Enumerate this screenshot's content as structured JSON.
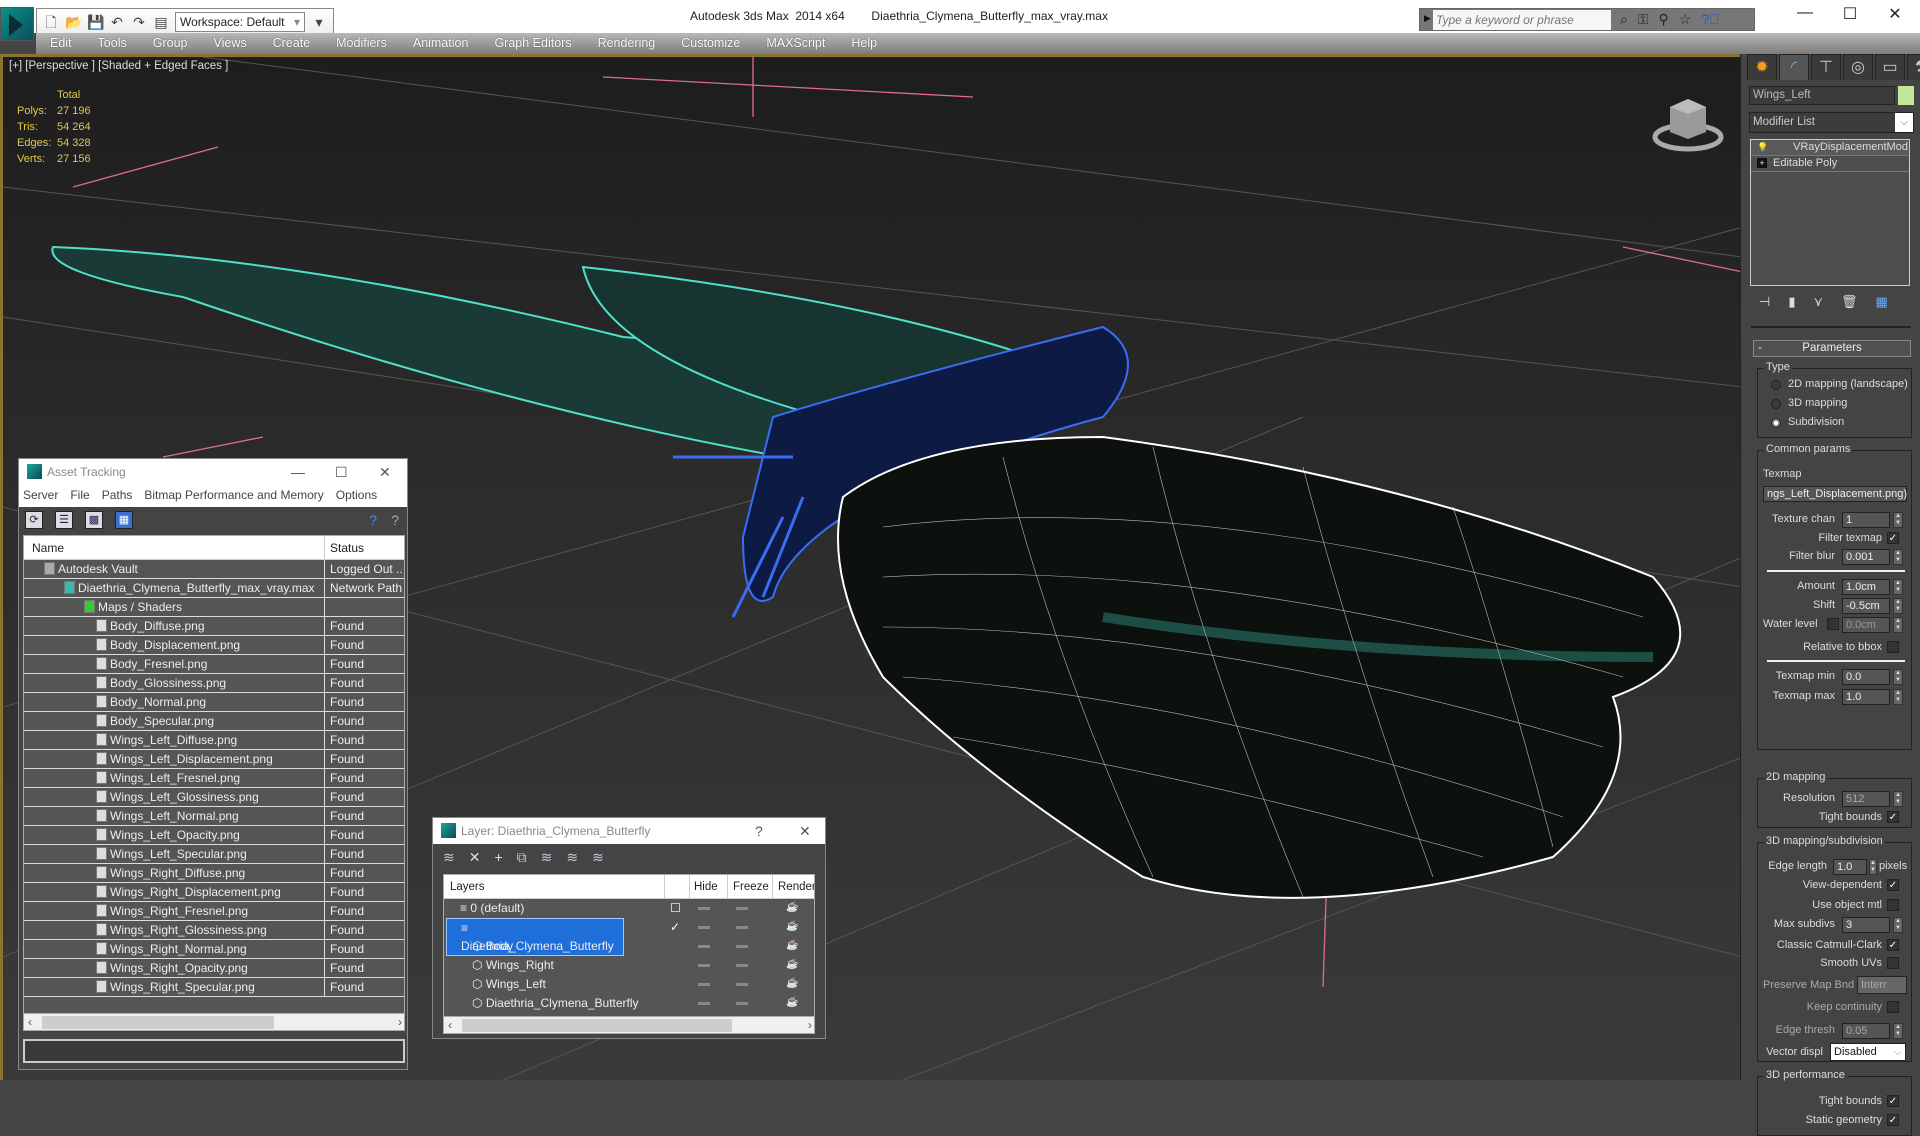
{
  "app": {
    "title": "Autodesk 3ds Max  2014 x64        Diaethria_Clymena_Butterfly_max_vray.max",
    "workspace": "Workspace: Default",
    "search_placeholder": "Type a keyword or phrase",
    "window_controls": [
      "—",
      "☐",
      "✕"
    ]
  },
  "menu": [
    "Edit",
    "Tools",
    "Group",
    "Views",
    "Create",
    "Modifiers",
    "Animation",
    "Graph Editors",
    "Rendering",
    "Customize",
    "MAXScript",
    "Help"
  ],
  "viewport": {
    "label": "[+] [Perspective ] [Shaded + Edged Faces ]",
    "stats_header": "Total",
    "stats": [
      {
        "k": "Polys:",
        "v": "27 196"
      },
      {
        "k": "Tris:",
        "v": "54 264"
      },
      {
        "k": "Edges:",
        "v": "54 328"
      },
      {
        "k": "Verts:",
        "v": "27 156"
      }
    ]
  },
  "command_panel": {
    "object_name": "Wings_Left",
    "object_color": "#c1e89a",
    "modifier_list": "Modifier List",
    "stack": [
      "VRayDisplacementMod",
      "Editable Poly"
    ],
    "rollout_title": "Parameters",
    "type_group": "Type",
    "type_options": [
      "2D mapping (landscape)",
      "3D mapping",
      "Subdivision"
    ],
    "type_selected": "Subdivision",
    "common_group": "Common params",
    "texmap_label": "Texmap",
    "texmap_value": "ngs_Left_Displacement.png)",
    "texture_chan": {
      "label": "Texture chan",
      "value": "1"
    },
    "filter_texmap": {
      "label": "Filter texmap",
      "checked": true
    },
    "filter_blur": {
      "label": "Filter blur",
      "value": "0.001"
    },
    "amount": {
      "label": "Amount",
      "value": "1.0cm"
    },
    "shift": {
      "label": "Shift",
      "value": "-0.5cm"
    },
    "water_level": {
      "label": "Water level",
      "value": "0.0cm",
      "checked": false
    },
    "relative_bbox": {
      "label": "Relative to bbox",
      "checked": false
    },
    "texmap_min": {
      "label": "Texmap min",
      "value": "0.0"
    },
    "texmap_max": {
      "label": "Texmap max",
      "value": "1.0"
    },
    "mapping2d_group": "2D mapping",
    "resolution": {
      "label": "Resolution",
      "value": "512"
    },
    "tight_bounds_2d": {
      "label": "Tight bounds",
      "checked": true
    },
    "mapping3d_group": "3D mapping/subdivision",
    "edge_length": {
      "label": "Edge length",
      "value": "1.0",
      "unit": "pixels"
    },
    "view_dependent": {
      "label": "View-dependent",
      "checked": true
    },
    "use_object_mtl": {
      "label": "Use object mtl",
      "checked": false
    },
    "max_subdivs": {
      "label": "Max subdivs",
      "value": "3"
    },
    "classic_cc": {
      "label": "Classic Catmull-Clark",
      "checked": true
    },
    "smooth_uvs": {
      "label": "Smooth UVs",
      "checked": false
    },
    "preserve_map": {
      "label": "Preserve Map Bnd",
      "value": "Interr"
    },
    "keep_continuity": {
      "label": "Keep continuity",
      "checked": false
    },
    "edge_thresh": {
      "label": "Edge thresh",
      "value": "0.05"
    },
    "vector_displ": {
      "label": "Vector displ",
      "value": "Disabled"
    },
    "perf_group": "3D performance",
    "tight_bounds_3d": {
      "label": "Tight bounds",
      "checked": true
    },
    "static_geometry": {
      "label": "Static geometry",
      "checked": true
    }
  },
  "asset_tracking": {
    "title": "Asset Tracking",
    "menu": [
      "Server",
      "File",
      "Paths",
      "Bitmap Performance and Memory",
      "Options"
    ],
    "columns": [
      "Name",
      "Status"
    ],
    "rows": [
      {
        "name": "Autodesk Vault",
        "status": "Logged Out ..",
        "level": 0
      },
      {
        "name": "Diaethria_Clymena_Butterfly_max_vray.max",
        "status": "Network Path",
        "level": 1
      },
      {
        "name": "Maps / Shaders",
        "status": "",
        "level": 2
      },
      {
        "name": "Body_Diffuse.png",
        "status": "Found",
        "level": 3
      },
      {
        "name": "Body_Displacement.png",
        "status": "Found",
        "level": 3
      },
      {
        "name": "Body_Fresnel.png",
        "status": "Found",
        "level": 3
      },
      {
        "name": "Body_Glossiness.png",
        "status": "Found",
        "level": 3
      },
      {
        "name": "Body_Normal.png",
        "status": "Found",
        "level": 3
      },
      {
        "name": "Body_Specular.png",
        "status": "Found",
        "level": 3
      },
      {
        "name": "Wings_Left_Diffuse.png",
        "status": "Found",
        "level": 3
      },
      {
        "name": "Wings_Left_Displacement.png",
        "status": "Found",
        "level": 3
      },
      {
        "name": "Wings_Left_Fresnel.png",
        "status": "Found",
        "level": 3
      },
      {
        "name": "Wings_Left_Glossiness.png",
        "status": "Found",
        "level": 3
      },
      {
        "name": "Wings_Left_Normal.png",
        "status": "Found",
        "level": 3
      },
      {
        "name": "Wings_Left_Opacity.png",
        "status": "Found",
        "level": 3
      },
      {
        "name": "Wings_Left_Specular.png",
        "status": "Found",
        "level": 3
      },
      {
        "name": "Wings_Right_Diffuse.png",
        "status": "Found",
        "level": 3
      },
      {
        "name": "Wings_Right_Displacement.png",
        "status": "Found",
        "level": 3
      },
      {
        "name": "Wings_Right_Fresnel.png",
        "status": "Found",
        "level": 3
      },
      {
        "name": "Wings_Right_Glossiness.png",
        "status": "Found",
        "level": 3
      },
      {
        "name": "Wings_Right_Normal.png",
        "status": "Found",
        "level": 3
      },
      {
        "name": "Wings_Right_Opacity.png",
        "status": "Found",
        "level": 3
      },
      {
        "name": "Wings_Right_Specular.png",
        "status": "Found",
        "level": 3
      }
    ]
  },
  "layer_dialog": {
    "title": "Layer: Diaethria_Clymena_Butterfly",
    "help": "?",
    "columns": [
      "Layers",
      "Hide",
      "Freeze",
      "Render"
    ],
    "rows": [
      {
        "name": "0 (default)",
        "type": "layer",
        "level": 0,
        "current": false,
        "selected": false
      },
      {
        "name": "Diaethria_Clymena_Butterfly",
        "type": "layer",
        "level": 0,
        "current": true,
        "selected": true
      },
      {
        "name": "Body",
        "type": "object",
        "level": 1
      },
      {
        "name": "Wings_Right",
        "type": "object",
        "level": 1
      },
      {
        "name": "Wings_Left",
        "type": "object",
        "level": 1
      },
      {
        "name": "Diaethria_Clymena_Butterfly",
        "type": "object",
        "level": 1
      }
    ]
  }
}
